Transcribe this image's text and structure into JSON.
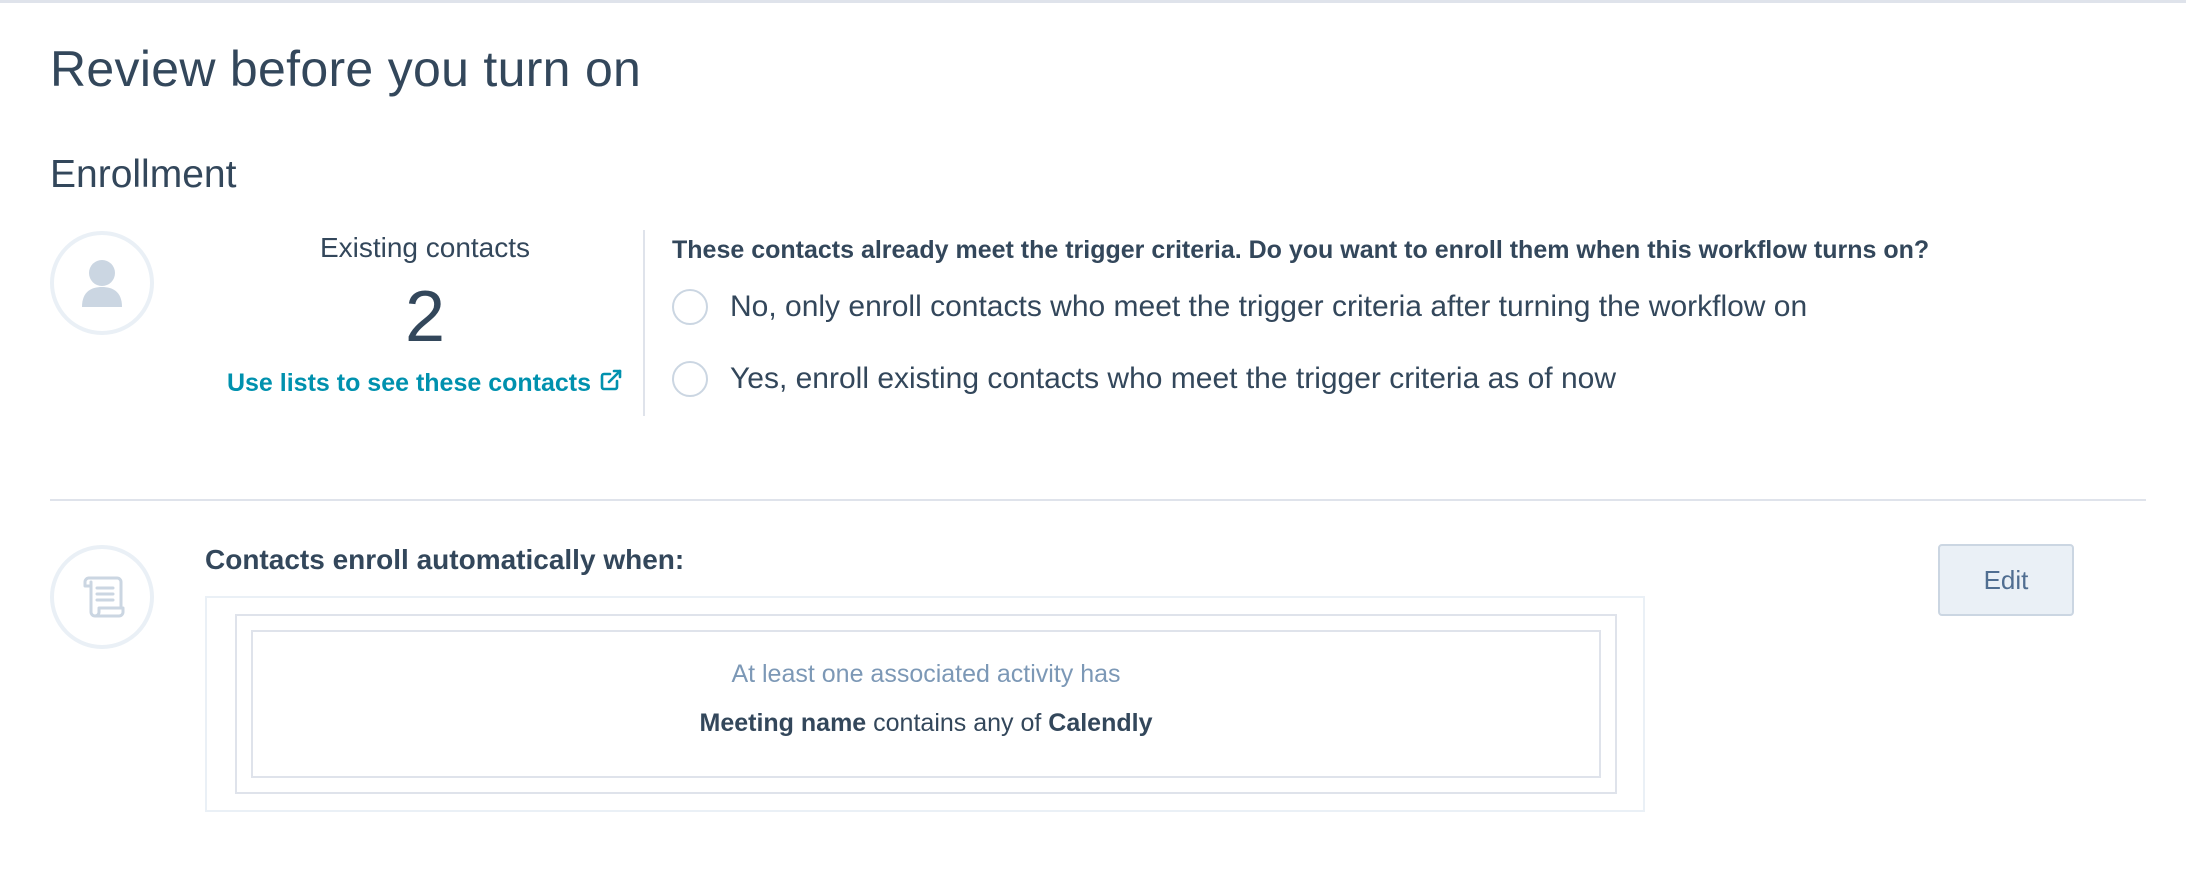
{
  "page": {
    "title": "Review before you turn on"
  },
  "enrollment": {
    "section_title": "Enrollment",
    "existing_label": "Existing contacts",
    "existing_count": "2",
    "lists_link": "Use lists to see these contacts",
    "question": "These contacts already meet the trigger criteria. Do you want to enroll them when this workflow turns on?",
    "options": [
      {
        "label": "No, only enroll contacts who meet the trigger criteria after turning the workflow on",
        "selected": false
      },
      {
        "label": "Yes, enroll existing contacts who meet the trigger criteria as of now",
        "selected": false
      }
    ],
    "icon": "contact-avatar-icon"
  },
  "trigger": {
    "title": "Contacts enroll automatically when:",
    "edit_label": "Edit",
    "icon": "scroll-icon",
    "filter_header": "At least one associated activity has",
    "filter_property": "Meeting name",
    "filter_operator": "contains any of",
    "filter_value": "Calendly"
  },
  "colors": {
    "text": "#33475b",
    "link": "#0091ae",
    "border": "#dfe3eb",
    "muted": "#7c98b6",
    "button_bg": "#eaf0f6"
  }
}
